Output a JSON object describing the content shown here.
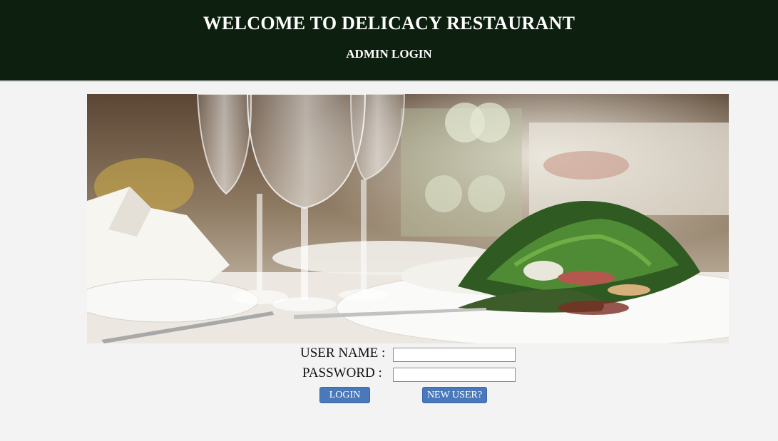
{
  "header": {
    "title": "WELCOME TO DELICACY RESTAURANT",
    "subtitle": "ADMIN LOGIN",
    "background_color": "#0d1f0e"
  },
  "banner": {
    "image_description": "restaurant-table-wine-glasses-salad"
  },
  "login_form": {
    "username_label": "USER NAME :",
    "username_value": "",
    "password_label": "PASSWORD :",
    "password_value": "",
    "login_button_label": "LOGIN",
    "new_user_button_label": "NEW USER?",
    "button_color": "#4a79bb"
  }
}
